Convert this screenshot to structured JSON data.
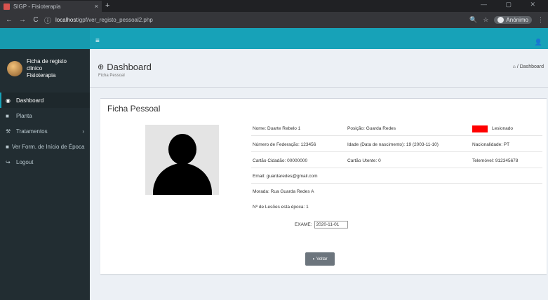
{
  "browser": {
    "tab_title": "SIGP - Fisioterapia",
    "tab_close": "×",
    "new_tab": "+",
    "win_controls": "—  ▢  ✕",
    "back": "←",
    "forward": "→",
    "reload": "C",
    "info": "ⓘ",
    "url_host": "localhost",
    "url_path": "/gpf/ver_registo_pessoal2.php",
    "zoom": "🔍",
    "star": "☆",
    "profile_label": "Anónimo",
    "menu": "⋮"
  },
  "header": {
    "hamburger": "≡",
    "user_icon": "👤"
  },
  "sidebar": {
    "user_name_line1": "Ficha de registo clinico",
    "user_name_line2": "Fisioterapia",
    "items": [
      {
        "icon": "◉",
        "label": "Dashboard",
        "caret": ""
      },
      {
        "icon": "■",
        "label": "Planta",
        "caret": ""
      },
      {
        "icon": "⚒",
        "label": "Tratamentos",
        "caret": "›"
      },
      {
        "icon": "■",
        "label": "Ver Form. de Início de Época",
        "caret": ""
      },
      {
        "icon": "↪",
        "label": "Logout",
        "caret": ""
      }
    ]
  },
  "content": {
    "title": "Dashboard",
    "subtitle": "Ficha Pessoal",
    "breadcrumb_icon": "⌂",
    "breadcrumb": "/ Dashboard",
    "dash_icon": "⊕"
  },
  "ficha": {
    "title": "Ficha Pessoal",
    "nome": "Nome: Duarte Rebelo 1",
    "posicao": "Posição: Guarda Redes",
    "status_label": "Lesionado",
    "federacao": "Número de Federação: 123456",
    "idade": "Idade (Data de nascimento): 19 (2003-11-10)",
    "nacionalidade": "Nacionalidade: PT",
    "cc": "Cartão Cidadão: 00000000",
    "utente": "Cartão Utente: 0",
    "telemovel": "Telemóvel: 912345678",
    "email": "Email: guardaredes@gmail.com",
    "morada": "Morada: Rua Guarda Redes A",
    "lesoes": "Nº de Lesões esta época: 1",
    "exame_label": "EXAME:",
    "exame_value": "2020-11-01",
    "voltar_label": "Voltar",
    "voltar_icon": "◐",
    "status_color": "#ff0000"
  }
}
